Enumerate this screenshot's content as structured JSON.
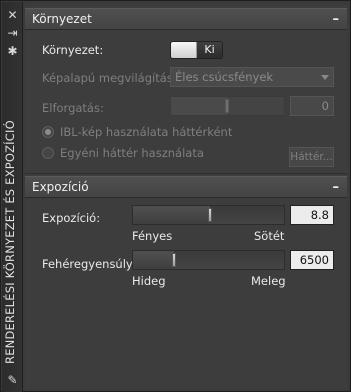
{
  "sidebar": {
    "title": "RENDERELÉSI KÖRNYEZET ÉS EXPOZÍCIÓ",
    "icons": [
      "close-icon",
      "pin-icon",
      "settings-icon",
      "properties-icon"
    ]
  },
  "environment": {
    "header": "Környezet",
    "collapse_glyph": "–",
    "toggle_label": "Környezet:",
    "toggle_state": "Ki",
    "lighting_label": "Képalapú megvilágítás:",
    "lighting_value": "Éles csúcsfények",
    "rotation_label": "Elforgatás:",
    "rotation_value": "0",
    "rotation_level": 0.5,
    "radio_ibl": "IBL-kép használata háttérként",
    "radio_custom": "Egyéni háttér használata",
    "background_button": "Háttér..."
  },
  "exposure": {
    "header": "Expozíció",
    "collapse_glyph": "–",
    "exposure_label": "Expozíció:",
    "exposure_value": "8.8",
    "exposure_level": 0.52,
    "exposure_min_label": "Fényes",
    "exposure_max_label": "Sötét",
    "wb_label": "Fehéregyensúly:",
    "wb_value": "6500",
    "wb_level": 0.27,
    "wb_min_label": "Hideg",
    "wb_max_label": "Meleg"
  },
  "colors": {
    "panel_bg": "#3d3d3d",
    "header_bg": "#4a4a4a",
    "text": "#eaeaea",
    "disabled_text": "#7f7f7f"
  }
}
